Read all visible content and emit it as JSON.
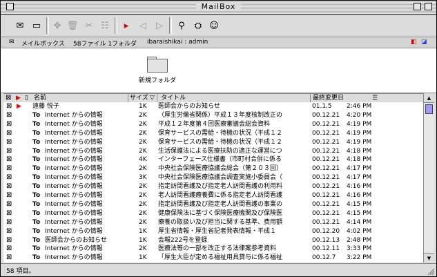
{
  "window": {
    "title": "MailBox"
  },
  "toolbar": {
    "items": [
      {
        "icon": "compose-icon"
      },
      {
        "icon": "folder-icon"
      },
      {
        "icon": "forward-icon"
      },
      {
        "icon": "trash-icon"
      },
      {
        "icon": "sort-icon"
      },
      {
        "icon": "filter-icon"
      },
      {
        "icon": "flag-arrow-icon"
      },
      {
        "icon": "prev-icon"
      },
      {
        "icon": "next-icon"
      },
      {
        "icon": "search-icon"
      },
      {
        "icon": "user-icon"
      },
      {
        "icon": "user-info-icon"
      }
    ]
  },
  "infobar": {
    "mailbox_label": "メイルボックス",
    "counts": "58ファイル 1フォルダ",
    "account": "ibaraishikai : admin"
  },
  "folder": {
    "label": "新規フォルダ"
  },
  "columns": {
    "name": "名前",
    "size": "サイズ",
    "title": "タイトル",
    "date": "最終変更日"
  },
  "messages": [
    {
      "to": "",
      "from": "遠藤 悦子",
      "size": "1K",
      "title": "医師会からのお知らせ",
      "date": "01.1.5",
      "time": "2:46 PM",
      "flag": true
    },
    {
      "to": "To",
      "from": "Internet からの情報",
      "size": "2K",
      "title": "（厚生労働省関係）平成１３年度核制改正の",
      "date": "00.12.21",
      "time": "4:20 PM",
      "flag": false
    },
    {
      "to": "To",
      "from": "Internet からの情報",
      "size": "2K",
      "title": "平成１２年度第４回医療審議会総会資料",
      "date": "00.12.21",
      "time": "4:19 PM",
      "flag": false
    },
    {
      "to": "To",
      "from": "Internet からの情報",
      "size": "2K",
      "title": "保育サービスの需給・待機の状況（平成１２",
      "date": "00.12.21",
      "time": "4:19 PM",
      "flag": false
    },
    {
      "to": "To",
      "from": "Internet からの情報",
      "size": "2K",
      "title": "保育サービスの需給・待機の状況（平成１２",
      "date": "00.12.21",
      "time": "4:19 PM",
      "flag": false
    },
    {
      "to": "To",
      "from": "Internet からの情報",
      "size": "2K",
      "title": "生活保護法による医療扶助の適正な運営につ",
      "date": "00.12.21",
      "time": "4:18 PM",
      "flag": false
    },
    {
      "to": "To",
      "from": "Internet からの情報",
      "size": "4K",
      "title": "インターフェース仕様書（市町村合併に係る",
      "date": "00.12.21",
      "time": "4:18 PM",
      "flag": false
    },
    {
      "to": "To",
      "from": "Internet からの情報",
      "size": "2K",
      "title": "中央社会保険医療協議会総会（第２０３回）",
      "date": "00.12.21",
      "time": "4:17 PM",
      "flag": false
    },
    {
      "to": "To",
      "from": "Internet からの情報",
      "size": "3K",
      "title": "中央社会保険医療協議会調査実施小委員会（",
      "date": "00.12.21",
      "time": "4:17 PM",
      "flag": false
    },
    {
      "to": "To",
      "from": "Internet からの情報",
      "size": "2K",
      "title": "指定訪問看護及び指定老人訪問看護の利用料",
      "date": "00.12.21",
      "time": "4:16 PM",
      "flag": false
    },
    {
      "to": "To",
      "from": "Internet からの情報",
      "size": "2K",
      "title": "老人訪問看護療養費に係る指定老人訪問看護",
      "date": "00.12.21",
      "time": "4:16 PM",
      "flag": false
    },
    {
      "to": "To",
      "from": "Internet からの情報",
      "size": "2K",
      "title": "指定訪問看護及び指定老人訪問看護の事業の",
      "date": "00.12.21",
      "time": "4:15 PM",
      "flag": false
    },
    {
      "to": "To",
      "from": "Internet からの情報",
      "size": "2K",
      "title": "健康保険法に基づく保険医療機関及び保険医",
      "date": "00.12.21",
      "time": "4:15 PM",
      "flag": false
    },
    {
      "to": "To",
      "from": "Internet からの情報",
      "size": "2K",
      "title": "療養の取扱い及び担当に関する基準、费用額",
      "date": "00.12.21",
      "time": "4:14 PM",
      "flag": false
    },
    {
      "to": "To",
      "from": "Internet からの情報",
      "size": "1K",
      "title": "厚生省情報・厚生省記者発表情報・平成１",
      "date": "00.12.20",
      "time": "4:02 PM",
      "flag": false
    },
    {
      "to": "To",
      "from": "医師会からのお知らせ",
      "size": "1K",
      "title": "会報222号を登録",
      "date": "00.12.13",
      "time": "2:48 PM",
      "flag": false
    },
    {
      "to": "To",
      "from": "Internet からの情報",
      "size": "2K",
      "title": "医療法等の一部を改正する法律案参考資料",
      "date": "00.12.11",
      "time": "3:33 PM",
      "flag": false
    },
    {
      "to": "To",
      "from": "Internet からの情報",
      "size": "1K",
      "title": "「厚生大臣が定める福祉用具貸与に係る福祉",
      "date": "00.12.7",
      "time": "3:22 PM",
      "flag": false
    }
  ],
  "status": {
    "text": "58 項目。"
  }
}
